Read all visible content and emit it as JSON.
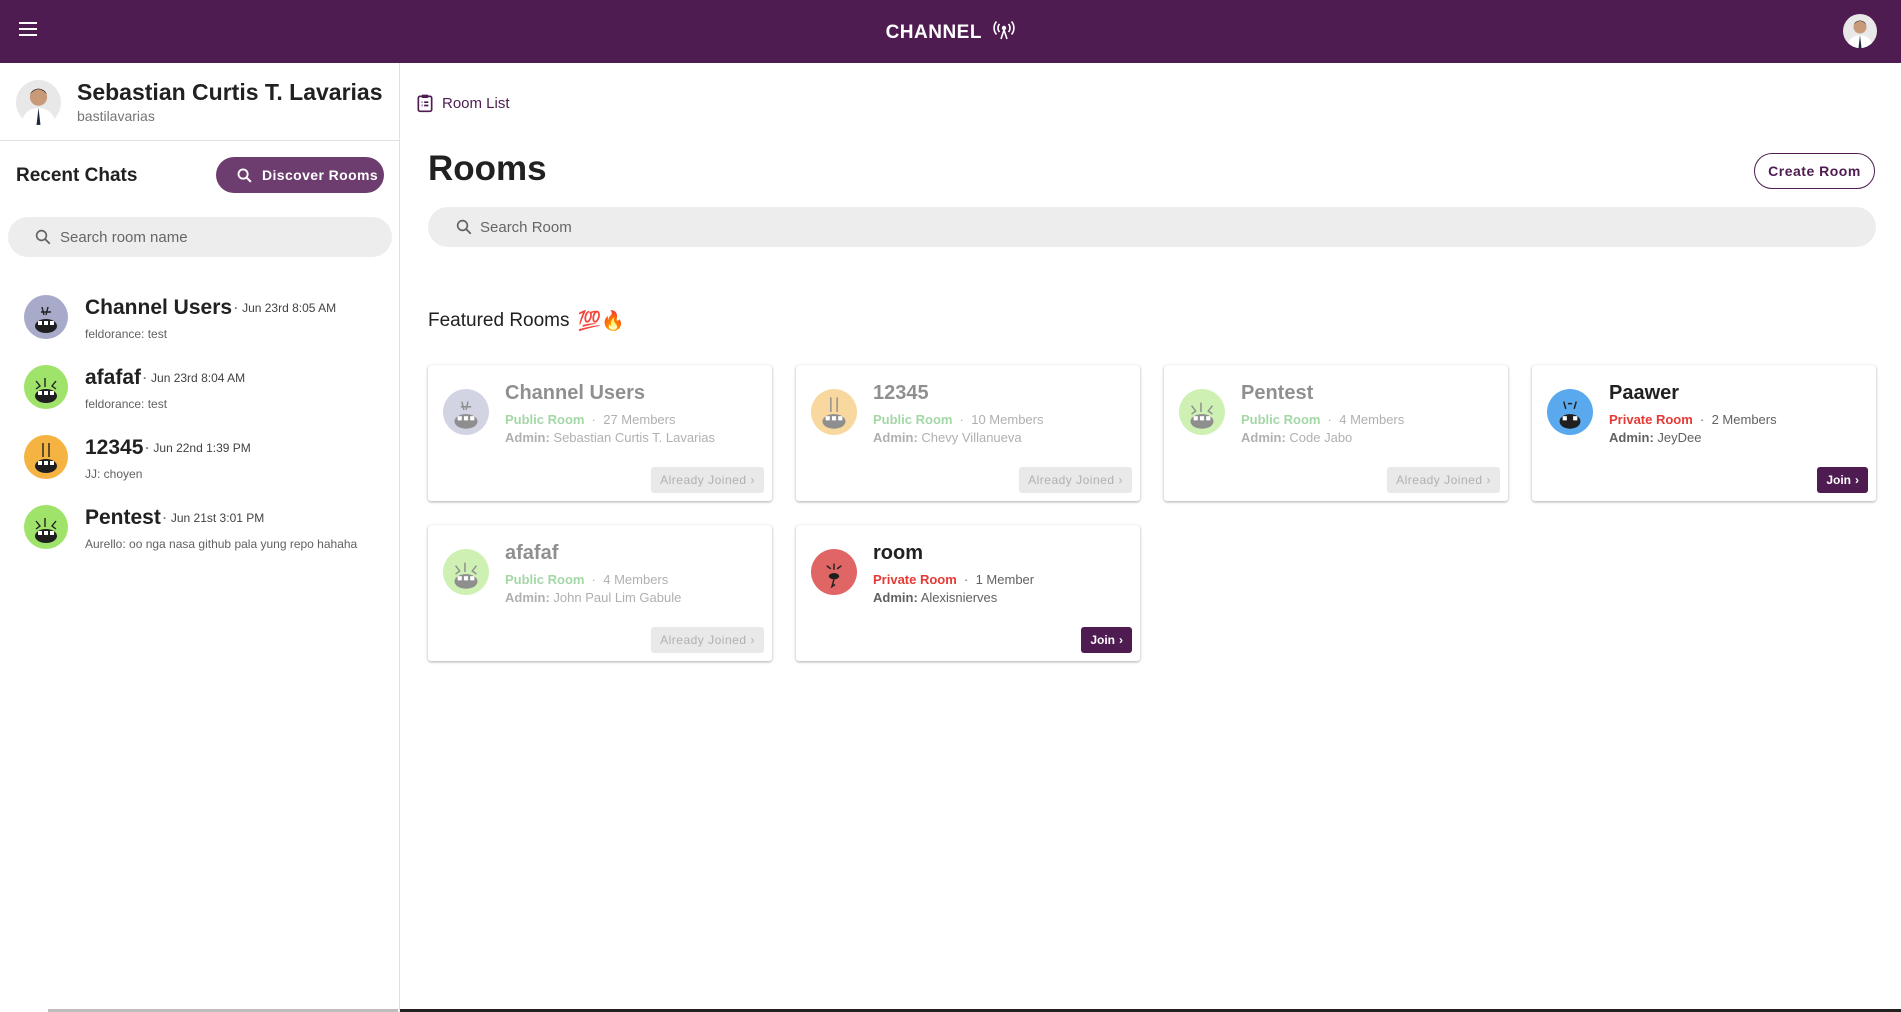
{
  "header": {
    "brand": "CHANNEL",
    "brand_icon": "broadcast-icon",
    "menu_icon": "hamburger-icon",
    "accent_color": "#4f1c51"
  },
  "profile": {
    "name": "Sebastian Curtis T. Lavarias",
    "username": "bastilavarias"
  },
  "sidebar": {
    "recent_title": "Recent Chats",
    "discover_label": "Discover Rooms",
    "search_placeholder": "Search room name",
    "chats": [
      {
        "name": "Channel Users",
        "time": "Jun 23rd 8:05 AM",
        "last": "feldorance: test",
        "color": "#a7aac9"
      },
      {
        "name": "afafaf",
        "time": "Jun 23rd 8:04 AM",
        "last": "feldorance: test",
        "color": "#9fe36a"
      },
      {
        "name": "12345",
        "time": "Jun 22nd 1:39 PM",
        "last": "JJ: choyen",
        "color": "#f5b342"
      },
      {
        "name": "Pentest",
        "time": "Jun 21st 3:01 PM",
        "last": "Aurello: oo nga nasa github pala yung repo hahaha",
        "color": "#9fe36a"
      }
    ]
  },
  "main": {
    "breadcrumb": "Room List",
    "title": "Rooms",
    "create_label": "Create Room",
    "search_placeholder": "Search Room",
    "featured_title": "Featured Rooms",
    "featured_emoji": "💯🔥",
    "rooms": [
      {
        "name": "Channel Users",
        "type": "Public Room",
        "members": "27 Members",
        "admin_label": "Admin:",
        "admin": "Sebastian Curtis T. Lavarias",
        "button": "Already Joined",
        "color": "#a7aac9"
      },
      {
        "name": "12345",
        "type": "Public Room",
        "members": "10 Members",
        "admin_label": "Admin:",
        "admin": "Chevy Villanueva",
        "button": "Already Joined",
        "color": "#f5b342"
      },
      {
        "name": "Pentest",
        "type": "Public Room",
        "members": "4 Members",
        "admin_label": "Admin:",
        "admin": "Code Jabo",
        "button": "Already Joined",
        "color": "#9fe36a"
      },
      {
        "name": "Paawer",
        "type": "Private Room",
        "members": "2 Members",
        "admin_label": "Admin:",
        "admin": "JeyDee",
        "button": "Join",
        "color": "#5aa9ee"
      },
      {
        "name": "afafaf",
        "type": "Public Room",
        "members": "4 Members",
        "admin_label": "Admin:",
        "admin": "John Paul Lim Gabule",
        "button": "Already Joined",
        "color": "#9fe36a"
      },
      {
        "name": "room",
        "type": "Private Room",
        "members": "1 Member",
        "admin_label": "Admin:",
        "admin": "Alexisnierves",
        "button": "Join",
        "color": "#e06666"
      }
    ]
  }
}
